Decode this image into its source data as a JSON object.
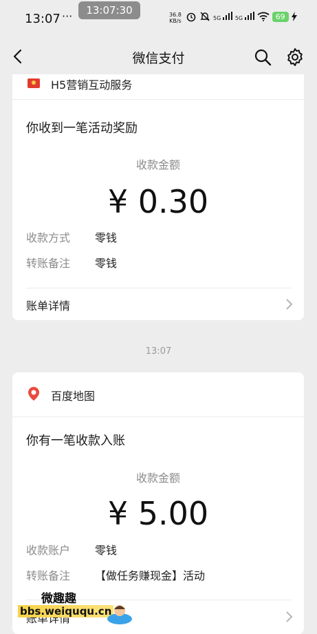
{
  "status_bar": {
    "time": "13:07",
    "dots": "···",
    "recording_time": "13:07:30",
    "net_speed": "36.8",
    "net_unit": "KB/s",
    "sig1": "5G",
    "sig2": "5G",
    "battery": "69"
  },
  "nav": {
    "title": "微信支付"
  },
  "messages": [
    {
      "source": "H5营销互动服务",
      "title": "你收到一笔活动奖励",
      "amount_label": "收款金额",
      "amount": "¥ 0.30",
      "details": [
        {
          "key": "收款方式",
          "value": "零钱"
        },
        {
          "key": "转账备注",
          "value": "零钱"
        }
      ],
      "bill_label": "账单详情"
    },
    {
      "timestamp": "13:07",
      "source": "百度地图",
      "title": "你有一笔收款入账",
      "amount_label": "收款金额",
      "amount": "¥ 5.00",
      "details": [
        {
          "key": "收款账户",
          "value": "零钱"
        },
        {
          "key": "转账备注",
          "value": "【做任务赚现金】活动"
        }
      ],
      "bill_label": "账单详情"
    }
  ],
  "watermark": {
    "title": "微趣趣",
    "url": "bbs.weiququ.cn"
  },
  "colors": {
    "background": "#ededed",
    "card": "#ffffff",
    "muted_text": "#8b8b8b",
    "battery": "#6ad26a"
  }
}
